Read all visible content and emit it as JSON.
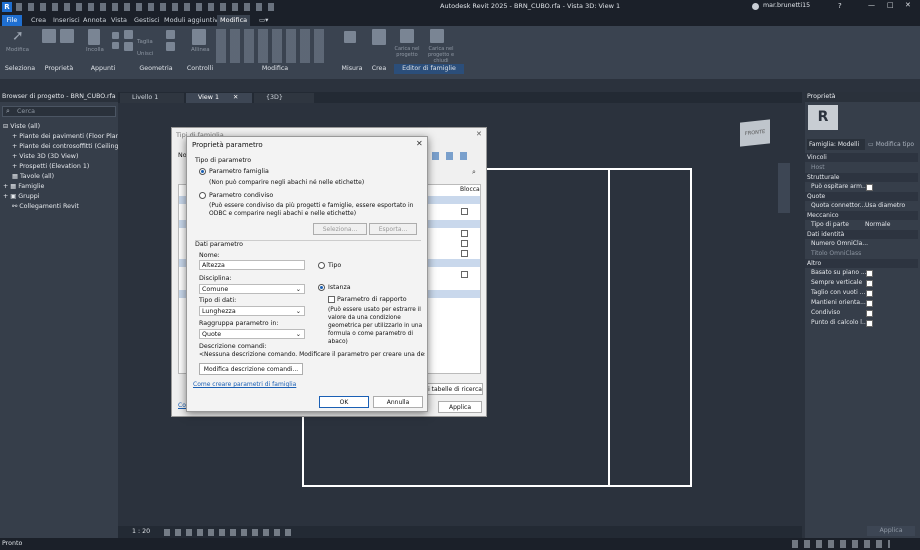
{
  "app": {
    "title": "Autodesk Revit 2025 - BRN_CUBO.rfa - Vista 3D: View 1",
    "user": "mar.brunetti15"
  },
  "menu": [
    "File",
    "Crea",
    "Inserisci",
    "Annota",
    "Vista",
    "Gestisci",
    "Moduli aggiuntivi",
    "Modifica"
  ],
  "ribbon": {
    "groups": [
      "Seleziona",
      "Proprietà",
      "Appunti",
      "Geometria",
      "Controlli",
      "Modifica",
      "Misura",
      "Crea",
      "Editor di famiglie"
    ],
    "tools": [
      "Modifica",
      "Incolla",
      "Taglia",
      "Unisci",
      "Allinea",
      "Carica nel progetto",
      "Carica nel progetto e chiudi"
    ]
  },
  "browser": {
    "title": "Browser di progetto - BRN_CUBO.rfa",
    "search": "Cerca",
    "items": [
      "Viste (all)",
      "Piante dei pavimenti (Floor Plan)",
      "Piante dei controsoffitti (Ceiling Pl",
      "Viste 3D (3D View)",
      "Prospetti (Elevation 1)",
      "Tavole (all)",
      "Famiglie",
      "Gruppi",
      "Collegamenti Revit"
    ]
  },
  "tabs": [
    "Livello 1",
    "View 1",
    "{3D}"
  ],
  "viewbar": {
    "scale": "1 : 20"
  },
  "viewcube": "FRONTE",
  "status": "Pronto",
  "props": {
    "title": "Proprietà",
    "family": "Famiglia: Modelli",
    "edit_type": "Modifica tipo",
    "apply": "Applica",
    "host_label": "Host",
    "sections": [
      "Vincoli",
      "Strutturale",
      "Quote",
      "Meccanico",
      "Dati identità",
      "Altro"
    ],
    "rows": [
      {
        "label": "Può ospitare arm...",
        "value": ""
      },
      {
        "label": "Quota connettor...",
        "value": "Usa diametro"
      },
      {
        "label": "Tipo di parte",
        "value": "Normale"
      },
      {
        "label": "Numero OmniCla...",
        "value": ""
      },
      {
        "label": "Titolo OmniClass",
        "value": ""
      },
      {
        "label": "Basato su piano ...",
        "value": ""
      },
      {
        "label": "Sempre verticale",
        "value": ""
      },
      {
        "label": "Taglio con vuoti ...",
        "value": ""
      },
      {
        "label": "Mantieni orienta...",
        "value": ""
      },
      {
        "label": "Condiviso",
        "value": ""
      },
      {
        "label": "Punto di calcolo l...",
        "value": ""
      }
    ]
  },
  "typedlg": {
    "title": "Tipi di famiglia",
    "name_label": "No",
    "col": "Blocca",
    "footer_btn": "i tabelle di ricerca",
    "apply": "Applica",
    "link": "Com"
  },
  "pdlg": {
    "title": "Proprietà parametro",
    "type_group": "Tipo di parametro",
    "family_param": "Parametro famiglia",
    "family_note": "(Non può comparire negli abachi né nelle etichette)",
    "shared_param": "Parametro condiviso",
    "shared_note": "(Può essere condiviso da più progetti e famiglie, essere esportato in ODBC e comparire negli abachi e nelle etichette)",
    "select_btn": "Seleziona...",
    "export_btn": "Esporta...",
    "data_group": "Dati parametro",
    "name_label": "Nome:",
    "name_value": "Altezza",
    "type_radio": "Tipo",
    "discipline_label": "Disciplina:",
    "discipline_value": "Comune",
    "instance_radio": "Istanza",
    "datatype_label": "Tipo di dati:",
    "datatype_value": "Lunghezza",
    "report_label": "Parametro di rapporto",
    "report_note": "(Può essere usato per estrarre il valore da una condizione geometrica per utilizzarlo in una formula o come parametro di abaco)",
    "group_label": "Raggruppa parametro in:",
    "group_value": "Quote",
    "desc_label": "Descrizione comandi:",
    "desc_value": "<Nessuna descrizione comando. Modificare il parametro per creare una descrizione",
    "desc_btn": "Modifica descrizione comandi...",
    "link": "Come creare parametri di famiglia",
    "ok": "OK",
    "cancel": "Annulla"
  }
}
